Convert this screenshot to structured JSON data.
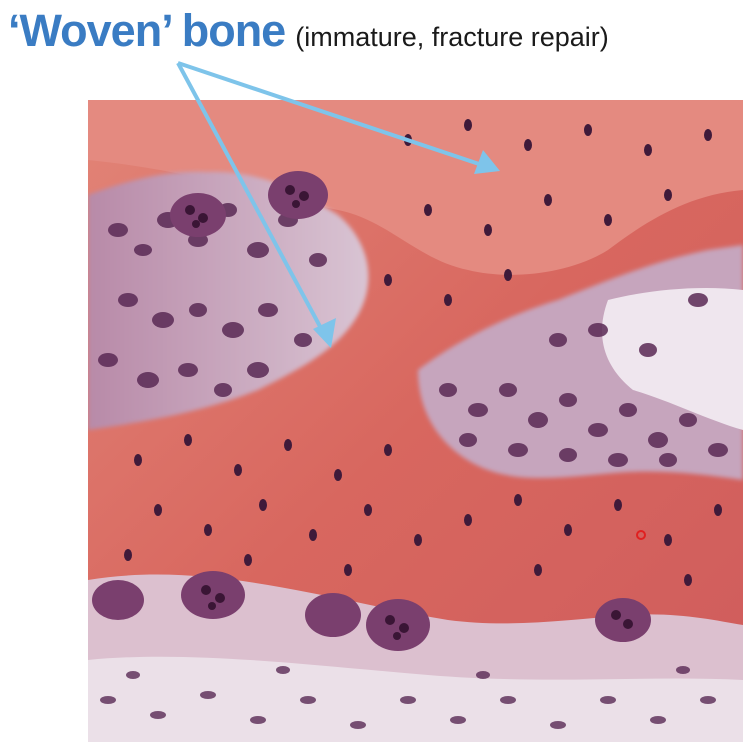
{
  "title": {
    "main": "‘Woven’ bone",
    "subtitle": "(immature, fracture repair)"
  },
  "colors": {
    "title_main": "#3a7cc3",
    "title_subtitle": "#1a1a1a",
    "arrow": "#7ec4ea",
    "bone_matrix": "#d96a63",
    "bone_matrix_light": "#e48a80",
    "cell_nuclei": "#4a2040",
    "marrow_purple": "#8a5a8f",
    "connective_tissue": "#efe6ee"
  },
  "image": {
    "subject": "histology-micrograph-woven-bone",
    "stain": "hematoxylin-eosin"
  }
}
